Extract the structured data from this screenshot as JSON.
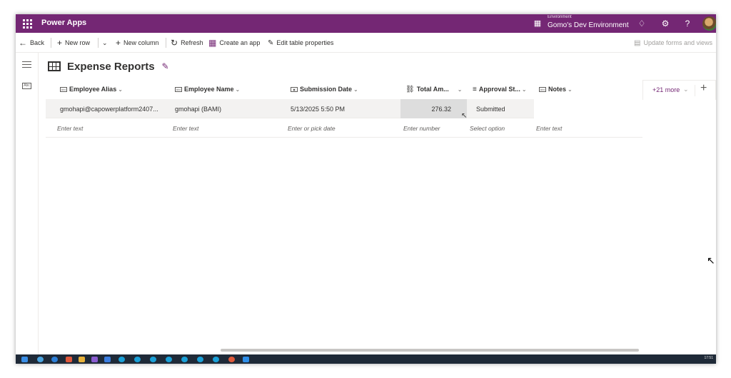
{
  "topbar": {
    "app_title": "Power Apps",
    "environment_label": "Environment",
    "environment_name": "Gomo's Dev Environment",
    "help_glyph": "?"
  },
  "commands": {
    "back": "Back",
    "new_row": "New row",
    "new_column": "New column",
    "refresh": "Refresh",
    "create_app": "Create an app",
    "edit_table_properties": "Edit table properties",
    "update_forms": "Update forms and views"
  },
  "table": {
    "title": "Expense Reports",
    "columns": [
      {
        "label": "Employee Alias"
      },
      {
        "label": "Employee Name"
      },
      {
        "label": "Submission Date"
      },
      {
        "label": "Total Am..."
      },
      {
        "label": "Approval St..."
      },
      {
        "label": "Notes"
      }
    ],
    "more_columns": "+21 more",
    "rows": [
      {
        "employee_alias": "gmohapi@capowerplatform2407...",
        "employee_name": "gmohapi (BAMI)",
        "submission_date": "5/13/2025 5:50 PM",
        "total_amount": "276.32",
        "approval_status": "Submitted",
        "notes": ""
      }
    ],
    "new_row_placeholders": {
      "employee_alias": "Enter text",
      "employee_name": "Enter text",
      "submission_date": "Enter or pick date",
      "total_amount": "Enter number",
      "approval_status": "Select option",
      "notes": "Enter text"
    }
  },
  "taskbar": {
    "clock": "17:51"
  },
  "colors": {
    "brand": "#742774",
    "selected_cell": "#dddddd"
  }
}
